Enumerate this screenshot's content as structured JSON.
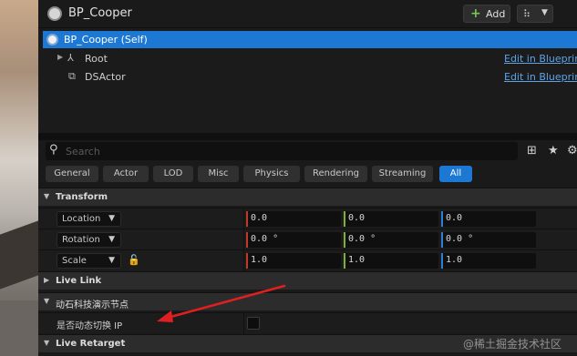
{
  "header": {
    "title": "BP_Cooper",
    "add_label": "Add",
    "blueprint_icon": "blueprint-actor-icon",
    "options_icon": "component-options-icon"
  },
  "tree": {
    "self_label": "BP_Cooper (Self)",
    "items": [
      {
        "label": "Root",
        "icon": "scene-root-icon",
        "link": "Edit in Blueprint"
      },
      {
        "label": "DSActor",
        "icon": "component-icon",
        "link": "Edit in Blueprint"
      }
    ]
  },
  "search": {
    "placeholder": "Search"
  },
  "tabs": [
    "General",
    "Actor",
    "LOD",
    "Misc",
    "Physics",
    "Rendering",
    "Streaming",
    "All"
  ],
  "active_tab": "All",
  "transform": {
    "section_label": "Transform",
    "location": {
      "label": "Location",
      "x": "0.0",
      "y": "0.0",
      "z": "0.0"
    },
    "rotation": {
      "label": "Rotation",
      "x": "0.0 °",
      "y": "0.0 °",
      "z": "0.0 °"
    },
    "scale": {
      "label": "Scale",
      "x": "1.0",
      "y": "1.0",
      "z": "1.0"
    }
  },
  "sections": {
    "live_link": "Live Link",
    "custom": "动石科技演示节点",
    "live_retarget": "Live Retarget"
  },
  "custom_prop": {
    "label": "是否动态切换 IP",
    "checked": false
  },
  "watermark": "@稀土掘金技术社区",
  "colors": {
    "accent": "#1d78d4",
    "axis_x": "#c0392b",
    "axis_y": "#7fb034",
    "axis_z": "#2f7fd6",
    "annotation": "#e02020"
  }
}
